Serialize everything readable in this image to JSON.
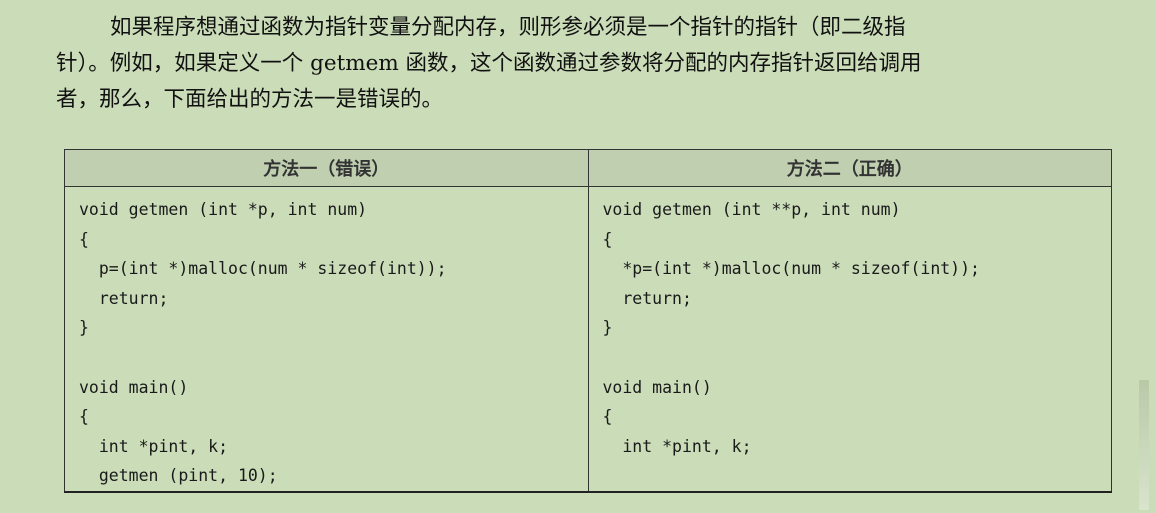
{
  "paragraph": {
    "lines": [
      "如果程序想通过函数为指针变量分配内存，则形参必须是一个指针的指针（即二级指",
      "针）。例如，如果定义一个 getmem 函数，这个函数通过参数将分配的内存指针返回给调用",
      "者，那么，下面给出的方法一是错误的。"
    ]
  },
  "table": {
    "headers": [
      "方法一（错误）",
      "方法二（正确）"
    ],
    "columns": [
      {
        "code": [
          "void getmen (int *p, int num)",
          "{",
          "  p=(int *)malloc(num * sizeof(int));",
          "  return;",
          "}",
          "",
          "void main()",
          "{",
          "  int *pint, k;",
          "  getmen (pint, 10);"
        ]
      },
      {
        "code": [
          "void getmen (int **p, int num)",
          "{",
          "  *p=(int *)malloc(num * sizeof(int));",
          "  return;",
          "}",
          "",
          "void main()",
          "{",
          "  int *pint, k;"
        ]
      }
    ]
  }
}
